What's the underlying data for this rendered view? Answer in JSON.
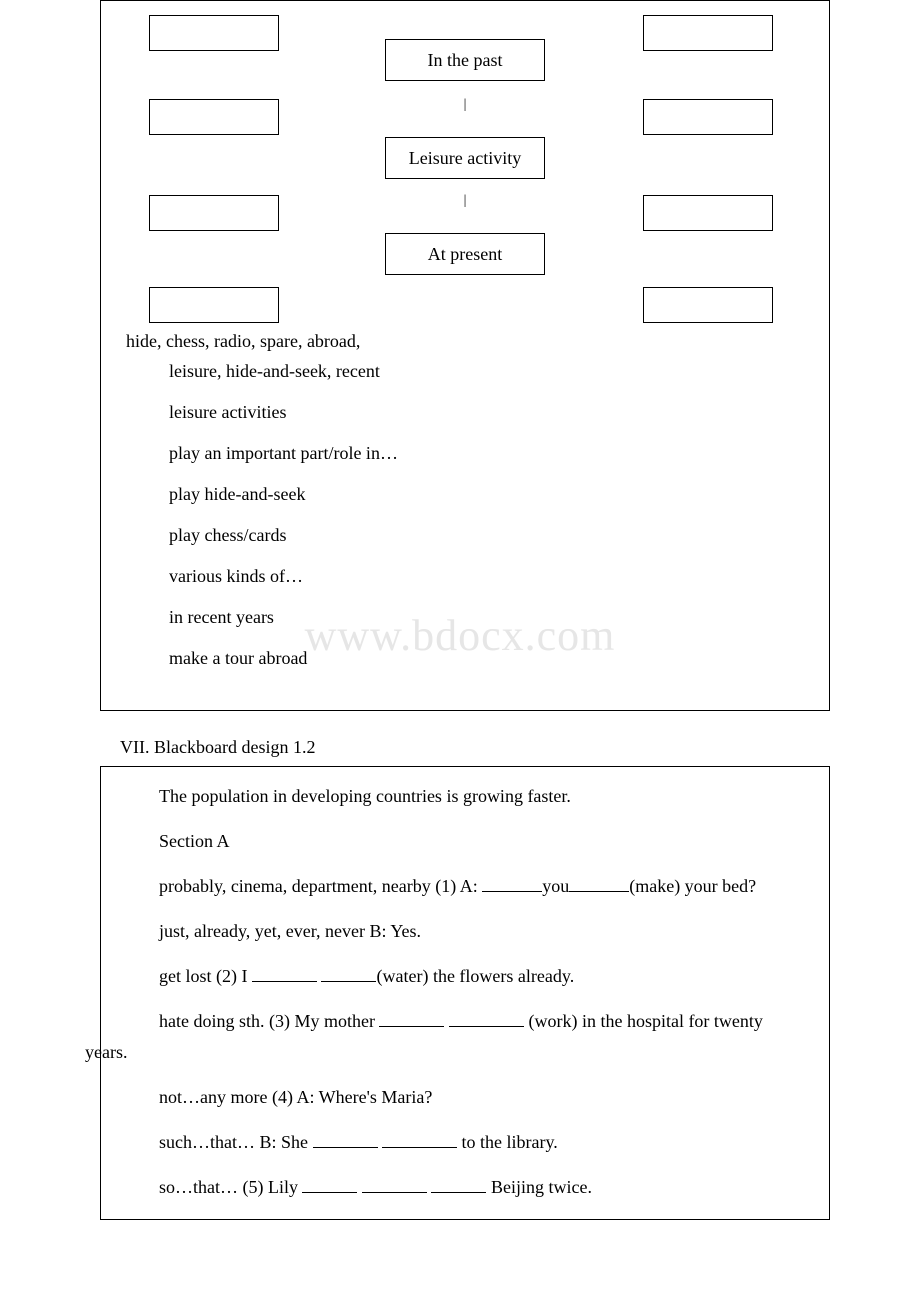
{
  "watermark": "www.bdocx.com",
  "diagram": {
    "center_top": "In the past",
    "center_mid": "Leisure activity",
    "center_bot": "At present"
  },
  "vocab_first": "hide, chess, radio, spare, abroad,",
  "vocab_lines": [
    "leisure, hide-and-seek, recent",
    "leisure activities",
    "play an important part/role in…",
    "play hide-and-seek",
    "play chess/cards",
    "various kinds of…",
    "in recent years",
    "make a tour abroad"
  ],
  "section_title": "VII. Blackboard design 1.2",
  "box2": {
    "line1": "The population in developing countries is growing faster.",
    "line2": "Section A",
    "q1_prefix": "probably, cinema, department, nearby (1) A: ",
    "q1_mid": "you",
    "q1_suffix": "(make) your bed?",
    "line4": "just, already, yet, ever, never  B: Yes.",
    "q2_prefix": "get lost (2) I ",
    "q2_suffix": "(water) the flowers already.",
    "q3_prefix": "hate doing sth. (3) My mother ",
    "q3_suffix": " (work) in the hospital for twenty",
    "q3_cont": "years.",
    "line7": "not…any more (4) A: Where's Maria?",
    "q4_prefix": "such…that… B: She ",
    "q4_suffix": " to the library.",
    "q5_prefix": "so…that… (5) Lily ",
    "q5_suffix": " Beijing twice."
  }
}
